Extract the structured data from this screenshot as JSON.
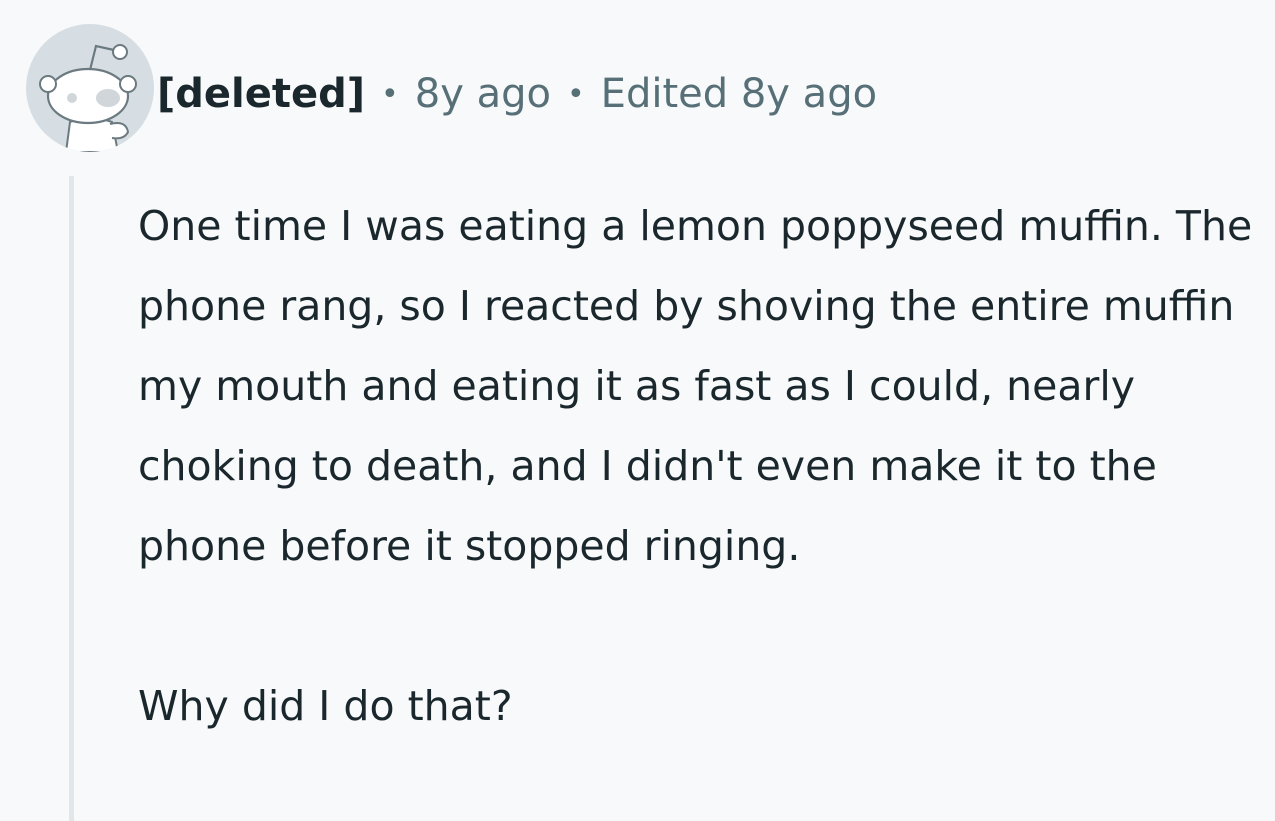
{
  "comment": {
    "author": "[deleted]",
    "separator": "•",
    "time_ago": "8y ago",
    "edited": "Edited 8y ago",
    "avatar_icon": "snoo-avatar-icon",
    "paragraphs": [
      "One time I was eating a lemon poppyseed muffin. The phone rang, so I reacted by shoving the entire muffin my mouth and eating it as fast as I could, nearly choking to death, and I didn't even make it to the phone before it stopped ringing.",
      "Why did I do that?"
    ]
  },
  "colors": {
    "background": "#f7f9fa",
    "text": "#1a282d",
    "meta_text": "#576f76",
    "thread_line": "#e1e6ea",
    "avatar_bg": "#d7dee3"
  }
}
